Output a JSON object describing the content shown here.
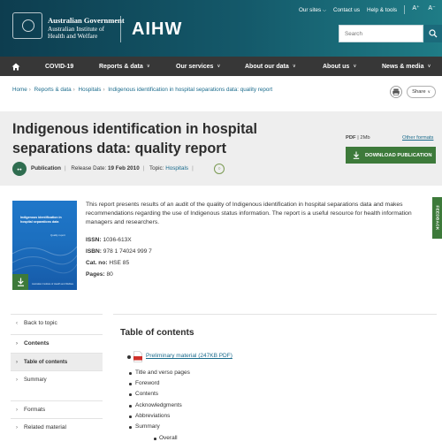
{
  "header": {
    "gov_line1": "Australian Government",
    "gov_line2": "Australian Institute of",
    "gov_line3": "Health and Welfare",
    "brand": "AIHW",
    "utility": {
      "our_sites": "Our sites",
      "contact": "Contact us",
      "help": "Help & tools",
      "font_up": "A⁺",
      "font_down": "A⁻"
    },
    "search_placeholder": "Search"
  },
  "nav": {
    "items": [
      "COVID-19",
      "Reports & data",
      "Our services",
      "About our data",
      "About us",
      "News & media"
    ]
  },
  "breadcrumb": {
    "items": [
      "Home",
      "Reports & data",
      "Hospitals",
      "Indigenous identification in hospital separations data: quality report"
    ],
    "share": "Share"
  },
  "hero": {
    "title": "Indigenous identification in hospital separations data: quality report",
    "pub_type": "Publication",
    "release_label": "Release Date:",
    "release_date": "19 Feb 2010",
    "topic_label": "Topic:",
    "topic": "Hospitals",
    "file_type": "PDF",
    "file_size": "2Mb",
    "other_formats": "Other formats",
    "download": "DOWNLOAD PUBLICATION"
  },
  "cover": {
    "title": "Indigenous identification in hospital separations data",
    "subtitle": "Quality report",
    "footer": "Australian Institute of Health and Welfare"
  },
  "summary": {
    "text": "This report presents results of an audit of the quality of Indigenous identification in hospital separations data and makes recommendations regarding the use of Indigenous status information. The report is a useful resource for health information managers and researchers.",
    "issn_label": "ISSN:",
    "issn": "1036-613X",
    "isbn_label": "ISBN:",
    "isbn": "978 1 74024 999 7",
    "cat_label": "Cat. no:",
    "cat": "HSE 85",
    "pages_label": "Pages:",
    "pages": "80"
  },
  "feedback": "FEEDBACK",
  "side_nav": {
    "back": "Back to topic",
    "contents": "Contents",
    "toc": "Table of contents",
    "summary": "Summary",
    "formats": "Formats",
    "related": "Related material"
  },
  "contents": {
    "title": "Table of contents",
    "pdf_link": "Preliminary material (247KB PDF)",
    "items": [
      "Title and verso pages",
      "Foreword",
      "Contents",
      "Acknowledgments",
      "Abbreviations",
      "Summary"
    ],
    "sub_items": [
      "Overall"
    ]
  },
  "colors": {
    "header_dark": "#0d3d4f",
    "header_light": "#1f7c86",
    "nav_bg": "#373737",
    "accent_green": "#3d7a3a",
    "link": "#1a6b8c"
  }
}
